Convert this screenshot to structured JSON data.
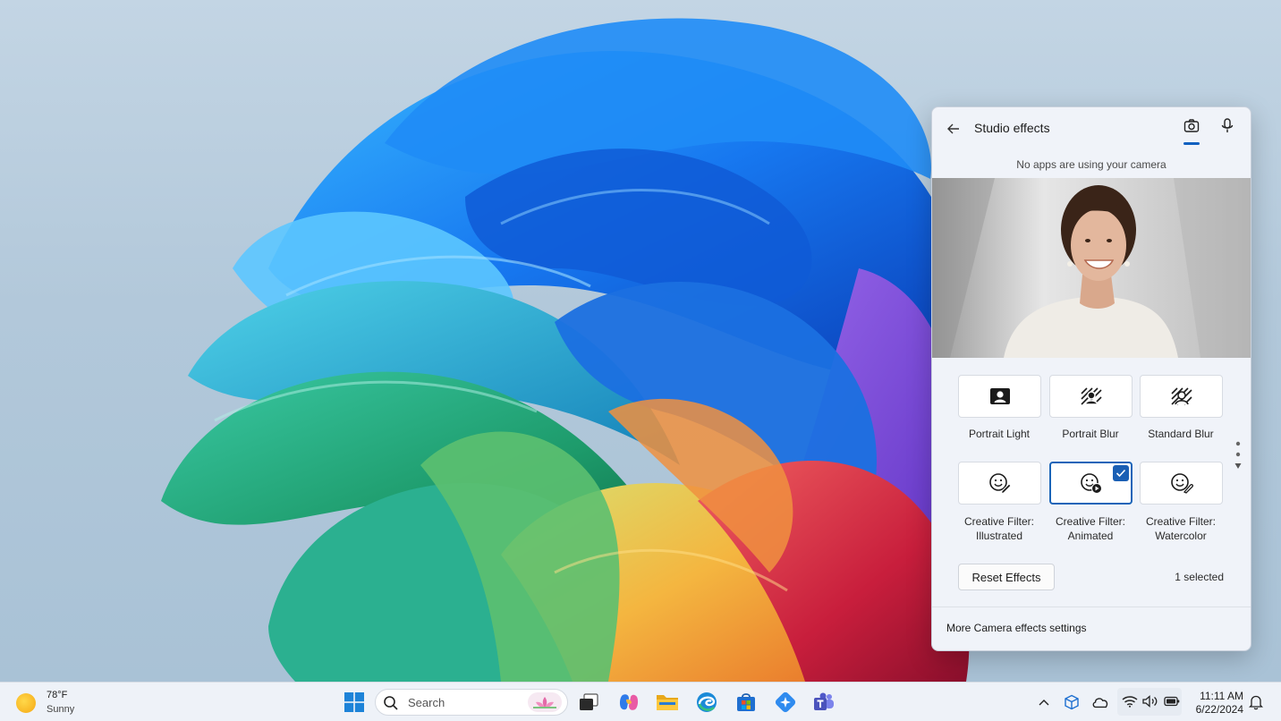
{
  "flyout": {
    "title": "Studio effects",
    "camera_status": "No apps are using your camera",
    "effects": [
      {
        "label": "Portrait Light",
        "icon": "portrait-light-icon",
        "selected": false
      },
      {
        "label": "Portrait Blur",
        "icon": "portrait-blur-icon",
        "selected": false
      },
      {
        "label": "Standard Blur",
        "icon": "standard-blur-icon",
        "selected": false
      },
      {
        "label_line1": "Creative Filter:",
        "label_line2": "Illustrated",
        "icon": "creative-filter-illustrated-icon",
        "selected": false
      },
      {
        "label_line1": "Creative Filter:",
        "label_line2": "Animated",
        "icon": "creative-filter-animated-icon",
        "selected": true
      },
      {
        "label_line1": "Creative Filter:",
        "label_line2": "Watercolor",
        "icon": "creative-filter-watercolor-icon",
        "selected": false
      }
    ],
    "reset_label": "Reset Effects",
    "selected_count": "1 selected",
    "more_settings": "More Camera effects settings"
  },
  "taskbar": {
    "weather": {
      "temperature": "78°F",
      "condition": "Sunny"
    },
    "search_placeholder": "Search",
    "clock": {
      "time": "11:11 AM",
      "date": "6/22/2024"
    }
  },
  "colors": {
    "accent": "#1a64b8",
    "flyout_bg": "#f0f3f9",
    "taskbar_bg": "#eef2f8"
  }
}
